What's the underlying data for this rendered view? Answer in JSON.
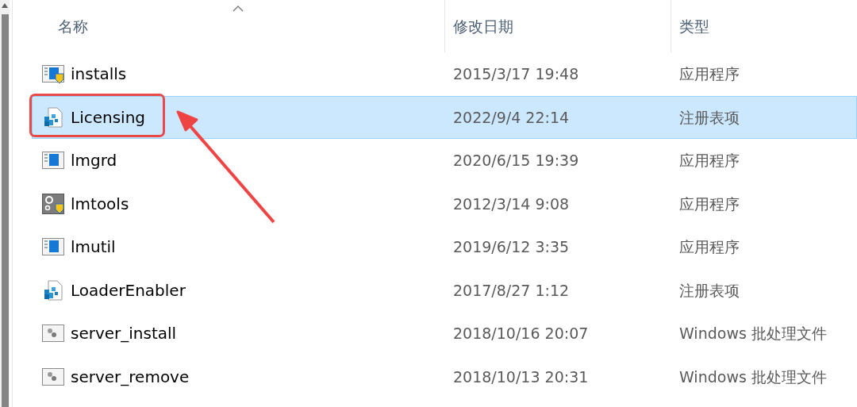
{
  "columns": [
    {
      "label": "名称",
      "sorted": true
    },
    {
      "label": "修改日期",
      "sorted": false
    },
    {
      "label": "类型",
      "sorted": false
    }
  ],
  "rows": [
    {
      "name": "installs",
      "kind": "app-shield",
      "date": "2015/3/17 19:48",
      "type": "应用程序",
      "selected": false
    },
    {
      "name": "Licensing",
      "kind": "registry",
      "date": "2022/9/4 22:14",
      "type": "注册表项",
      "selected": true
    },
    {
      "name": "lmgrd",
      "kind": "app",
      "date": "2020/6/15 19:39",
      "type": "应用程序",
      "selected": false
    },
    {
      "name": "lmtools",
      "kind": "tools",
      "date": "2012/3/14 9:08",
      "type": "应用程序",
      "selected": false
    },
    {
      "name": "lmutil",
      "kind": "app",
      "date": "2019/6/12 3:35",
      "type": "应用程序",
      "selected": false
    },
    {
      "name": "LoaderEnabler",
      "kind": "registry",
      "date": "2017/8/27 1:12",
      "type": "注册表项",
      "selected": false
    },
    {
      "name": "server_install",
      "kind": "batch",
      "date": "2018/10/16 20:07",
      "type": "Windows 批处理文件",
      "selected": false
    },
    {
      "name": "server_remove",
      "kind": "batch",
      "date": "2018/10/13 20:31",
      "type": "Windows 批处理文件",
      "selected": false
    }
  ]
}
